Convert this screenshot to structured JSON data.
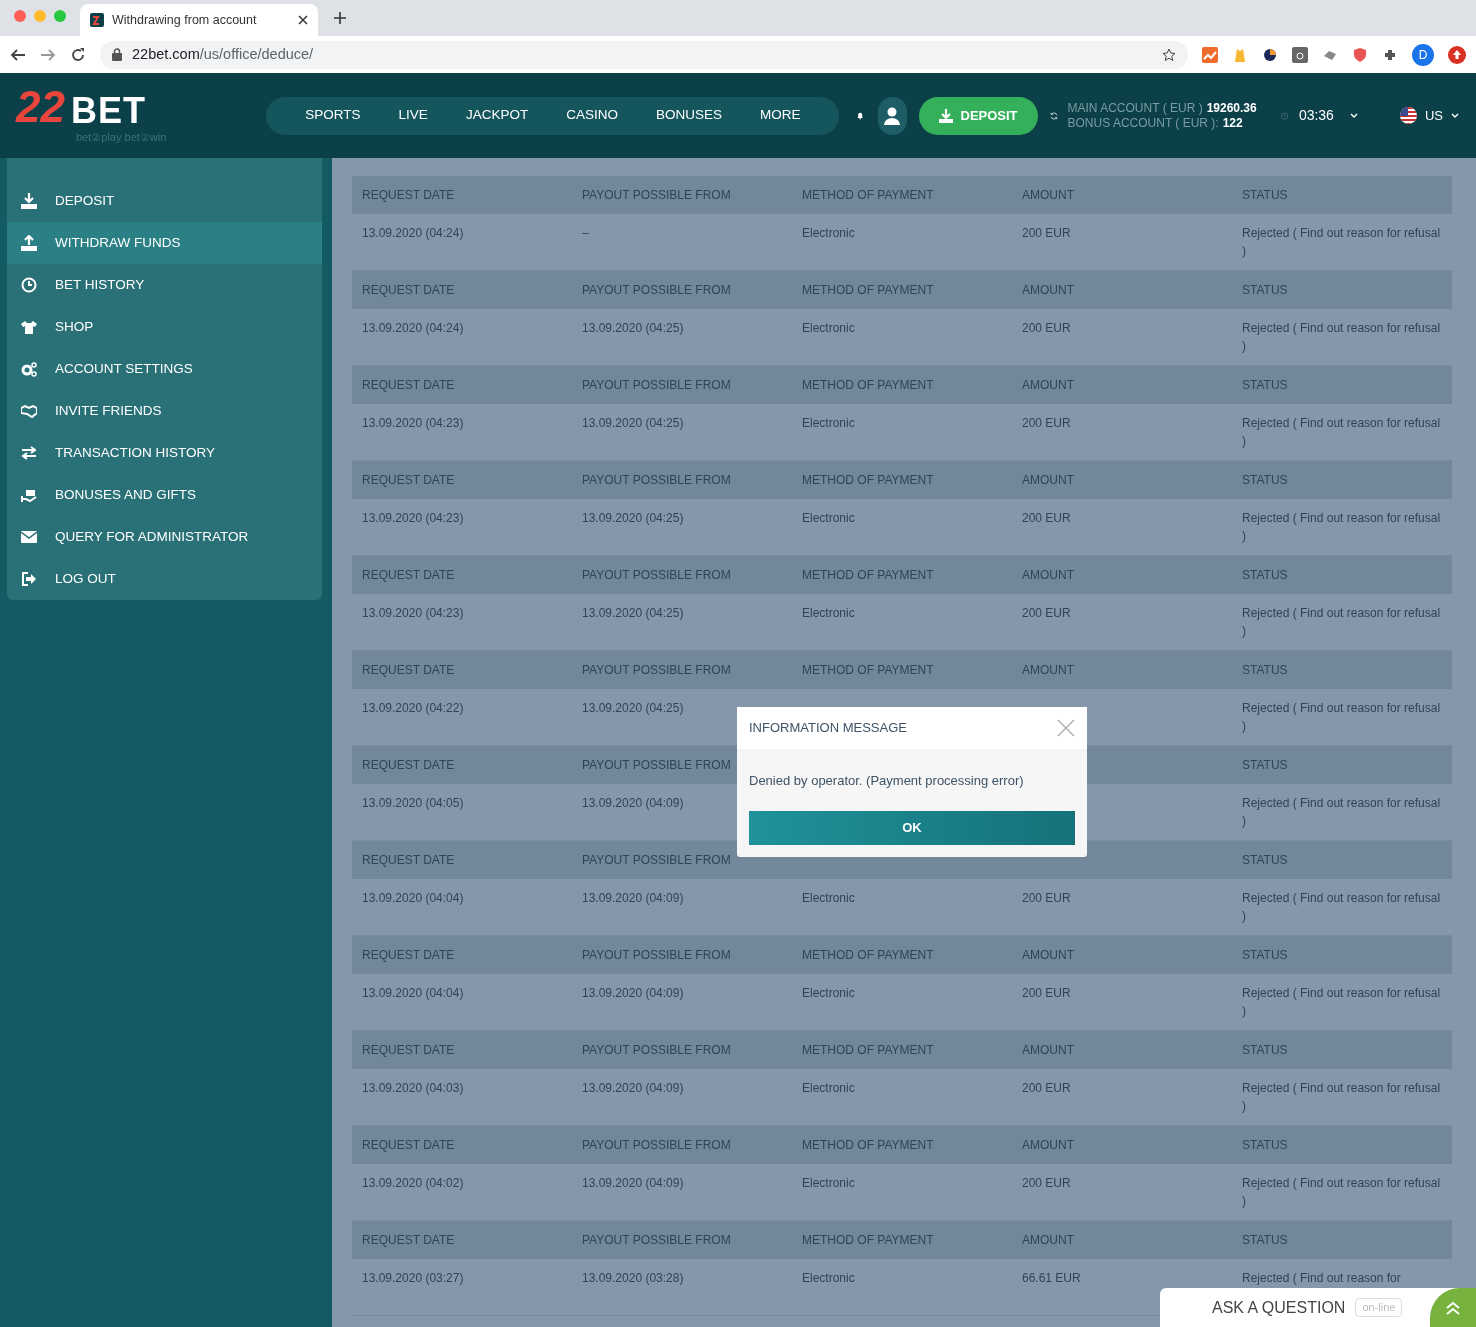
{
  "browser": {
    "tab_title": "Withdrawing from account",
    "url_domain": "22bet.com",
    "url_path": "/us/office/deduce/",
    "profile_initial": "D"
  },
  "header": {
    "logo_number": "22",
    "logo_word": "BET",
    "logo_tagline": "bet②play  bet②win",
    "nav": [
      {
        "label": "SPORTS",
        "selected": false
      },
      {
        "label": "LIVE",
        "selected": false
      },
      {
        "label": "JACKPOT",
        "selected": false
      },
      {
        "label": "CASINO",
        "selected": false
      },
      {
        "label": "BONUSES",
        "selected": false
      },
      {
        "label": "MORE",
        "selected": false
      }
    ],
    "deposit_button": "DEPOSIT",
    "main_account_label": "MAIN ACCOUNT ( EUR )",
    "main_balance": "19260.36",
    "bonus_account_label": "BONUS ACCOUNT ( EUR ):",
    "bonus_balance": "122",
    "time": "03:36",
    "language": "US"
  },
  "sidebar": {
    "items": [
      {
        "label": "DEPOSIT",
        "selected": false
      },
      {
        "label": "WITHDRAW FUNDS",
        "selected": true
      },
      {
        "label": "BET HISTORY",
        "selected": false
      },
      {
        "label": "SHOP",
        "selected": false
      },
      {
        "label": "ACCOUNT SETTINGS",
        "selected": false
      },
      {
        "label": "INVITE FRIENDS",
        "selected": false
      },
      {
        "label": "TRANSACTION HISTORY",
        "selected": false
      },
      {
        "label": "BONUSES AND GIFTS",
        "selected": false
      },
      {
        "label": "QUERY FOR ADMINISTRATOR",
        "selected": false
      },
      {
        "label": "LOG OUT",
        "selected": false
      }
    ]
  },
  "withdrawals": [
    {
      "headers": {
        "request_date": "REQUEST DATE",
        "payout_from": "PAYOUT POSSIBLE FROM",
        "method": "METHOD OF PAYMENT",
        "amount": "AMOUNT",
        "status": "STATUS"
      },
      "cells": {
        "request_date": "13.09.2020 (04:24)",
        "payout_from": "–",
        "method": "Electronic",
        "amount": "200 EUR",
        "status": "Rejected ( Find out reason for refusal )"
      }
    },
    {
      "headers": {
        "request_date": "REQUEST DATE",
        "payout_from": "PAYOUT POSSIBLE FROM",
        "method": "METHOD OF PAYMENT",
        "amount": "AMOUNT",
        "status": "STATUS"
      },
      "cells": {
        "request_date": "13.09.2020 (04:24)",
        "payout_from": "13.09.2020 (04:25)",
        "method": "Electronic",
        "amount": "200 EUR",
        "status": "Rejected ( Find out reason for refusal )"
      }
    },
    {
      "headers": {
        "request_date": "REQUEST DATE",
        "payout_from": "PAYOUT POSSIBLE FROM",
        "method": "METHOD OF PAYMENT",
        "amount": "AMOUNT",
        "status": "STATUS"
      },
      "cells": {
        "request_date": "13.09.2020 (04:23)",
        "payout_from": "13.09.2020 (04:25)",
        "method": "Electronic",
        "amount": "200 EUR",
        "status": "Rejected ( Find out reason for refusal )"
      }
    },
    {
      "headers": {
        "request_date": "REQUEST DATE",
        "payout_from": "PAYOUT POSSIBLE FROM",
        "method": "METHOD OF PAYMENT",
        "amount": "AMOUNT",
        "status": "STATUS"
      },
      "cells": {
        "request_date": "13.09.2020 (04:23)",
        "payout_from": "13.09.2020 (04:25)",
        "method": "Electronic",
        "amount": "200 EUR",
        "status": "Rejected ( Find out reason for refusal )"
      }
    },
    {
      "headers": {
        "request_date": "REQUEST DATE",
        "payout_from": "PAYOUT POSSIBLE FROM",
        "method": "METHOD OF PAYMENT",
        "amount": "AMOUNT",
        "status": "STATUS"
      },
      "cells": {
        "request_date": "13.09.2020 (04:23)",
        "payout_from": "13.09.2020 (04:25)",
        "method": "Electronic",
        "amount": "200 EUR",
        "status": "Rejected ( Find out reason for refusal )"
      }
    },
    {
      "headers": {
        "request_date": "REQUEST DATE",
        "payout_from": "PAYOUT POSSIBLE FROM",
        "method": "METHOD OF PAYMENT",
        "amount": "AMOUNT",
        "status": "STATUS"
      },
      "cells": {
        "request_date": "13.09.2020 (04:22)",
        "payout_from": "13.09.2020 (04:25)",
        "status": "Rejected ( Find out reason for refusal )"
      }
    },
    {
      "headers": {
        "request_date": "REQUEST DATE",
        "payout_from": "PAYOUT POSSIBLE FROM",
        "status": "STATUS"
      },
      "cells": {
        "request_date": "13.09.2020 (04:05)",
        "payout_from": "13.09.2020 (04:09)",
        "status": "Rejected ( Find out reason for refusal )"
      }
    },
    {
      "headers": {
        "request_date": "REQUEST DATE",
        "payout_from": "PAYOUT POSSIBLE FROM",
        "status": "STATUS"
      },
      "cells": {
        "request_date": "13.09.2020 (04:04)",
        "payout_from": "13.09.2020 (04:09)",
        "method": "Electronic",
        "amount": "200 EUR",
        "status": "Rejected ( Find out reason for refusal )"
      }
    },
    {
      "headers": {
        "request_date": "REQUEST DATE",
        "payout_from": "PAYOUT POSSIBLE FROM",
        "method": "METHOD OF PAYMENT",
        "amount": "AMOUNT",
        "status": "STATUS"
      },
      "cells": {
        "request_date": "13.09.2020 (04:04)",
        "payout_from": "13.09.2020 (04:09)",
        "method": "Electronic",
        "amount": "200 EUR",
        "status": "Rejected ( Find out reason for refusal )"
      }
    },
    {
      "headers": {
        "request_date": "REQUEST DATE",
        "payout_from": "PAYOUT POSSIBLE FROM",
        "method": "METHOD OF PAYMENT",
        "amount": "AMOUNT",
        "status": "STATUS"
      },
      "cells": {
        "request_date": "13.09.2020 (04:03)",
        "payout_from": "13.09.2020 (04:09)",
        "method": "Electronic",
        "amount": "200 EUR",
        "status": "Rejected ( Find out reason for refusal )"
      }
    },
    {
      "headers": {
        "request_date": "REQUEST DATE",
        "payout_from": "PAYOUT POSSIBLE FROM",
        "method": "METHOD OF PAYMENT",
        "amount": "AMOUNT",
        "status": "STATUS"
      },
      "cells": {
        "request_date": "13.09.2020 (04:02)",
        "payout_from": "13.09.2020 (04:09)",
        "method": "Electronic",
        "amount": "200 EUR",
        "status": "Rejected ( Find out reason for refusal )"
      }
    },
    {
      "headers": {
        "request_date": "REQUEST DATE",
        "payout_from": "PAYOUT POSSIBLE FROM",
        "method": "METHOD OF PAYMENT",
        "amount": "AMOUNT",
        "status": "STATUS"
      },
      "cells": {
        "request_date": "13.09.2020 (03:27)",
        "payout_from": "13.09.2020 (03:28)",
        "method": "Electronic",
        "amount": "66.61 EUR",
        "status": "Rejected ( Find out reason for"
      }
    }
  ],
  "modal": {
    "title": "INFORMATION MESSAGE",
    "message": "Denied by operator. (Payment processing error)",
    "button": "OK"
  },
  "chat": {
    "label": "ASK A QUESTION",
    "status": "on-line"
  }
}
